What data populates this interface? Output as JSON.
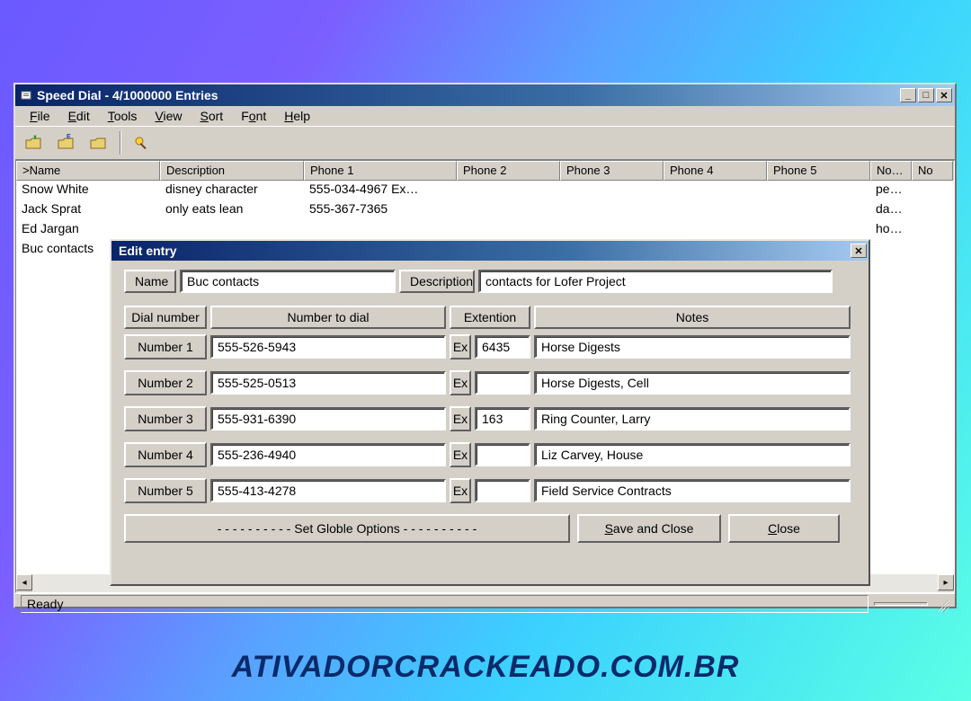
{
  "window": {
    "title": "Speed Dial - 4/1000000 Entries",
    "status": "Ready"
  },
  "menu": [
    "File",
    "Edit",
    "Tools",
    "View",
    "Sort",
    "Font",
    "Help"
  ],
  "columns": [
    ">Name",
    "Description",
    "Phone 1",
    "Phone 2",
    "Phone 3",
    "Phone 4",
    "Phone 5",
    "No…",
    "No"
  ],
  "rows": [
    {
      "name": "Snow White",
      "desc": "disney character",
      "p1": "555-034-4967 Ex…",
      "p2": "",
      "p3": "",
      "p4": "",
      "p5": "",
      "no1": "per…",
      "no2": ""
    },
    {
      "name": "Jack Sprat",
      "desc": "only eats lean",
      "p1": "555-367-7365",
      "p2": "",
      "p3": "",
      "p4": "",
      "p5": "",
      "no1": "da…",
      "no2": ""
    },
    {
      "name": "Ed Jargan",
      "desc": "",
      "p1": "",
      "p2": "",
      "p3": "",
      "p4": "",
      "p5": "",
      "no1": "home",
      "no2": ""
    },
    {
      "name": "Buc contacts",
      "desc": "",
      "p1": "",
      "p2": "",
      "p3": "",
      "p4": "",
      "p5": "",
      "no1": "",
      "no2": ""
    }
  ],
  "dialog": {
    "title": "Edit entry",
    "name_label": "Name",
    "name_value": "Buc contacts",
    "desc_label": "Description",
    "desc_value": "contacts for Lofer Project",
    "headers": {
      "dial": "Dial number",
      "num": "Number to dial",
      "ext": "Extention",
      "notes": "Notes"
    },
    "ex_label": "Ex",
    "numbers": [
      {
        "label": "Number 1",
        "num": "555-526-5943",
        "ext": "6435",
        "notes": "Horse Digests"
      },
      {
        "label": "Number 2",
        "num": "555-525-0513",
        "ext": "",
        "notes": "Horse Digests, Cell"
      },
      {
        "label": "Number 3",
        "num": "555-931-6390",
        "ext": "163",
        "notes": "Ring Counter, Larry"
      },
      {
        "label": "Number 4",
        "num": "555-236-4940",
        "ext": "",
        "notes": "Liz Carvey, House"
      },
      {
        "label": "Number 5",
        "num": "555-413-4278",
        "ext": "",
        "notes": "Field Service Contracts"
      }
    ],
    "buttons": {
      "globals": "- - - - - - - - - - Set Globle Options - - - - - - - - - -",
      "save": "Save and Close",
      "close": "Close"
    }
  },
  "watermark": "ATIVADORCRACKEADO.COM.BR"
}
